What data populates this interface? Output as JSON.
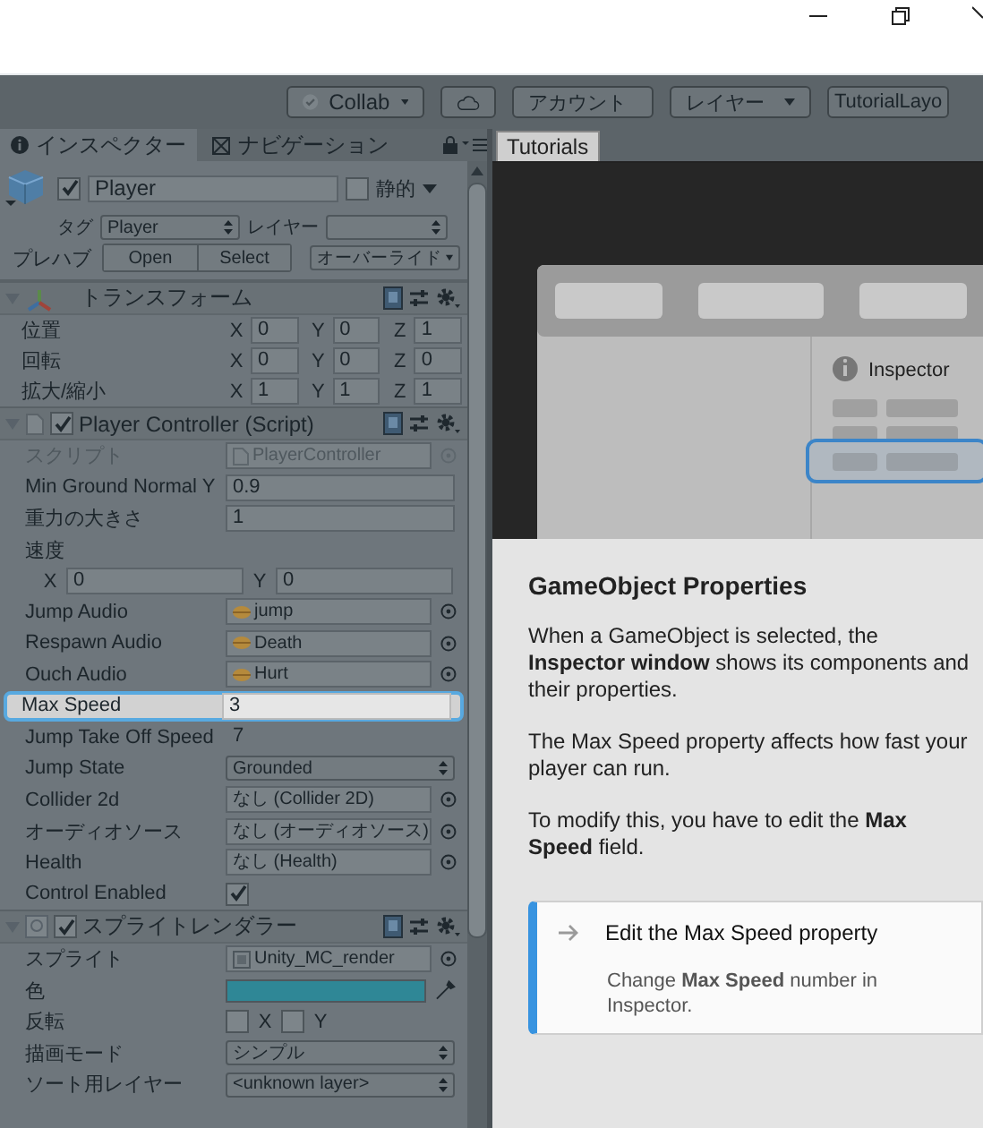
{
  "toolbar": [
    {
      "kind": "collab",
      "label": "Collab"
    },
    {
      "kind": "icon"
    },
    {
      "kind": "dropdown",
      "label": "アカウント"
    },
    {
      "kind": "dropdown",
      "label": "レイヤー"
    },
    {
      "kind": "plain",
      "label": "TutorialLayo"
    }
  ],
  "inspector": {
    "tabs": [
      {
        "label": "インスペクター",
        "selected": true
      },
      {
        "label": "ナビゲーション",
        "selected": false
      }
    ],
    "object": {
      "name": "Player",
      "active": true,
      "static_label": "静的",
      "static": false,
      "tag_label": "タグ",
      "tag": "Player",
      "layer_label": "レイヤー",
      "prefab_label": "プレハブ",
      "prefab_buttons": [
        "Open",
        "Select"
      ],
      "overrides": "オーバーライド"
    },
    "components": [
      {
        "kind": "transform",
        "title": "トランスフォーム",
        "expanded": true,
        "rows": [
          {
            "label": "位置",
            "values": [
              {
                "axis": "X",
                "value": "0"
              },
              {
                "axis": "Y",
                "value": "0"
              },
              {
                "axis": "Z",
                "value": "1"
              }
            ]
          },
          {
            "label": "回転",
            "values": [
              {
                "axis": "X",
                "value": "0"
              },
              {
                "axis": "Y",
                "value": "0"
              },
              {
                "axis": "Z",
                "value": "0"
              }
            ]
          },
          {
            "label": "拡大/縮小",
            "values": [
              {
                "axis": "X",
                "value": "1"
              },
              {
                "axis": "Y",
                "value": "1"
              },
              {
                "axis": "Z",
                "value": "1"
              }
            ]
          }
        ]
      },
      {
        "kind": "script",
        "title": "Player Controller (Script)",
        "enabled": true,
        "expanded": true,
        "properties": [
          {
            "kind": "script",
            "label": "スクリプト",
            "value": "PlayerController",
            "highlighted": false
          },
          {
            "kind": "text",
            "label": "Min Ground Normal Y",
            "value": "0.9",
            "highlighted": false
          },
          {
            "kind": "text",
            "label": "重力の大きさ",
            "value": "1",
            "highlighted": false
          },
          {
            "kind": "vector2",
            "label": "速度",
            "values": [
              {
                "axis": "X",
                "value": "0"
              },
              {
                "axis": "Y",
                "value": "0"
              }
            ],
            "highlighted": false
          },
          {
            "kind": "audio",
            "label": "Jump Audio",
            "value": "jump",
            "highlighted": false
          },
          {
            "kind": "audio",
            "label": "Respawn Audio",
            "value": "Death",
            "highlighted": false
          },
          {
            "kind": "audio",
            "label": "Ouch Audio",
            "value": "Hurt",
            "highlighted": false
          },
          {
            "kind": "text",
            "label": "Max Speed",
            "value": "3",
            "highlighted": true
          },
          {
            "kind": "plain",
            "label": "Jump Take Off Speed",
            "value": "7",
            "highlighted": false
          },
          {
            "kind": "enum",
            "label": "Jump State",
            "value": "Grounded",
            "highlighted": false
          },
          {
            "kind": "object",
            "label": "Collider 2d",
            "value": "なし (Collider 2D)",
            "highlighted": false
          },
          {
            "kind": "object",
            "label": "オーディオソース",
            "value": "なし (オーディオソース)",
            "highlighted": false
          },
          {
            "kind": "object",
            "label": "Health",
            "value": "なし (Health)",
            "highlighted": false
          },
          {
            "kind": "checkbox",
            "label": "Control Enabled",
            "checked": true,
            "highlighted": false
          }
        ]
      },
      {
        "kind": "sprite_renderer",
        "title": "スプライトレンダラー",
        "enabled": true,
        "expanded": true,
        "properties": [
          {
            "kind": "sprite",
            "label": "スプライト",
            "value": "Unity_MC_render",
            "highlighted": false
          },
          {
            "kind": "color",
            "label": "色",
            "color": "#2f8796",
            "highlighted": false
          },
          {
            "kind": "flip",
            "label": "反転",
            "values": [
              {
                "axis": "X",
                "checked": false
              },
              {
                "axis": "Y",
                "checked": false
              }
            ],
            "highlighted": false
          },
          {
            "kind": "enum",
            "label": "描画モード",
            "value": "シンプル",
            "highlighted": false
          },
          {
            "kind": "enum",
            "label": "ソート用レイヤー",
            "value": "<unknown layer>",
            "highlighted": false
          }
        ]
      }
    ]
  },
  "tutorial": {
    "tab": "Tutorials",
    "illustration_label": "Inspector",
    "title": "GameObject Properties",
    "paragraphs": [
      "When a GameObject is selected, the **Inspector window** shows its components and their properties.",
      "The Max Speed property affects how fast your player can run.",
      "To modify this, you have to edit the **Max Speed** field."
    ],
    "task": {
      "title": "Edit the Max Speed property",
      "description": "Change **Max Speed** number in Inspector."
    }
  }
}
